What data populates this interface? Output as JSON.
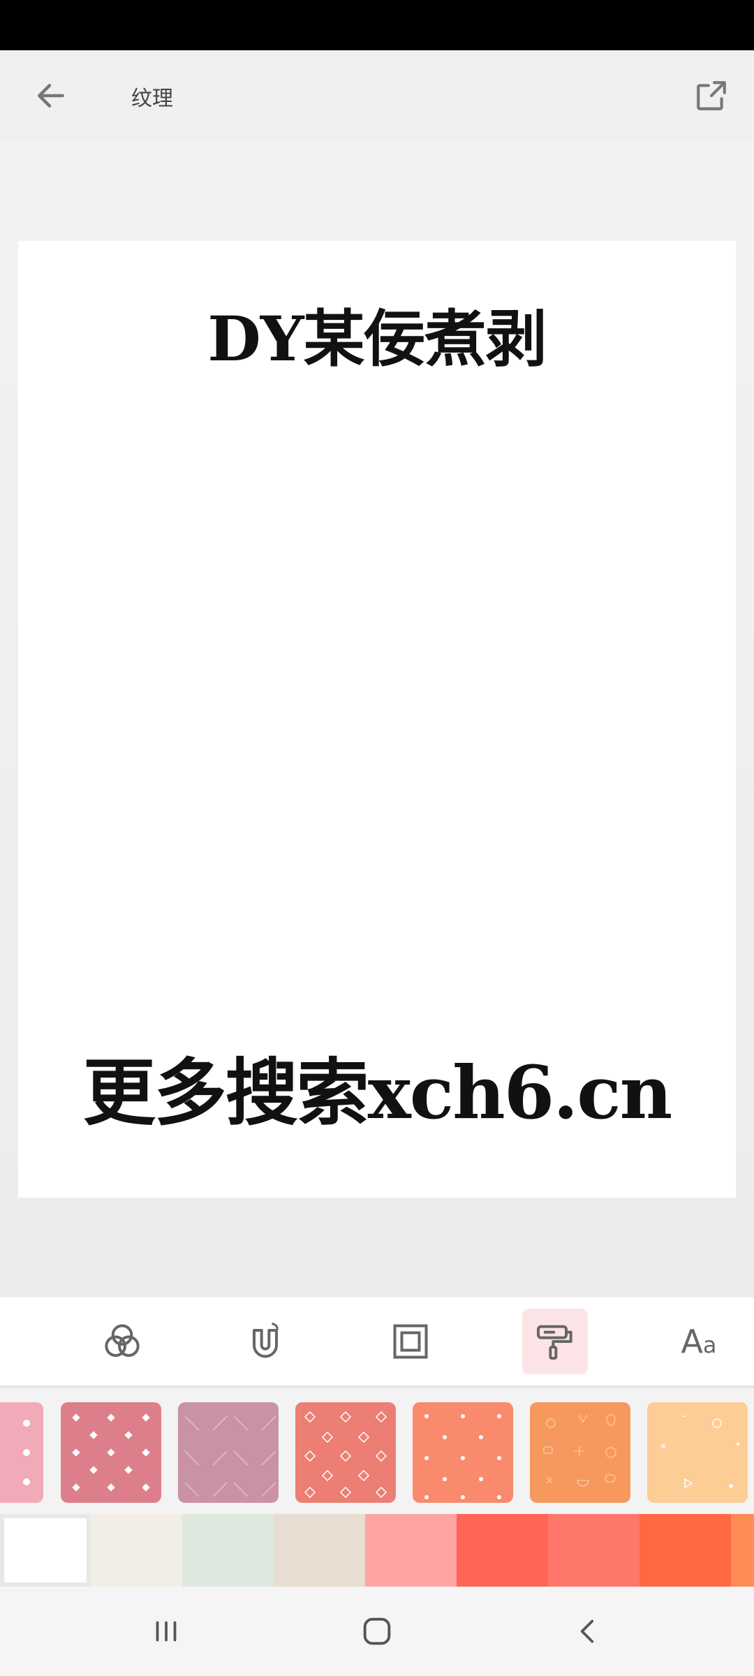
{
  "header": {
    "title": "纹理"
  },
  "canvas": {
    "top_text": "DY某佞煮剥",
    "bottom_text": "更多搜索xch6.cn"
  },
  "toolbar": {
    "tools": [
      "colors-icon",
      "magnet-icon",
      "frame-icon",
      "paint-roller-icon",
      "text-icon"
    ],
    "active": "paint-roller-icon",
    "text_tool_label_big": "A",
    "text_tool_label_small": "a"
  },
  "textures": [
    {
      "bg": "#f2a9b8",
      "pattern": "dots"
    },
    {
      "bg": "#dd7f8b",
      "pattern": "diamonds"
    },
    {
      "bg": "#c993a3",
      "pattern": "chevrons"
    },
    {
      "bg": "#ec7e74",
      "pattern": "outline-diamonds"
    },
    {
      "bg": "#fa8a6e",
      "pattern": "sparse-dots"
    },
    {
      "bg": "#f7995e",
      "pattern": "food-doodles"
    },
    {
      "bg": "#fdcd96",
      "pattern": "confetti"
    }
  ],
  "colors": [
    "#ffffff",
    "#f2eee5",
    "#dfe8df",
    "#e7ddd1",
    "#ffa3a3",
    "#ff6457",
    "#ff776a",
    "#ff6843",
    "#ff8b55"
  ],
  "selected_color_index": 0
}
